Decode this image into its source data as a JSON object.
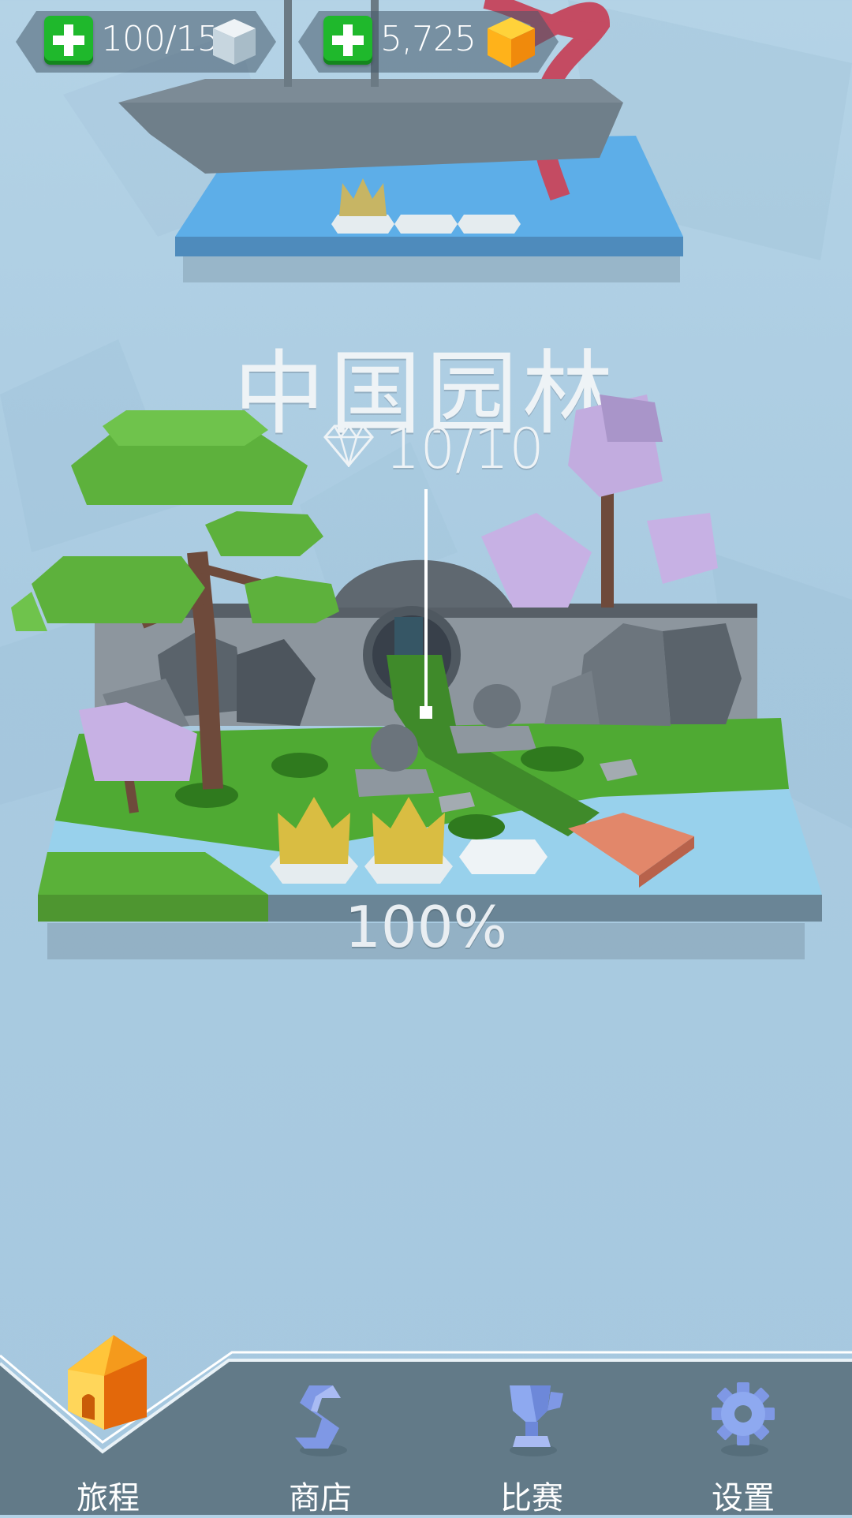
{
  "hud": {
    "energy": {
      "value": "100/15",
      "add_icon": "plus-icon",
      "resource_icon": "cube-icon"
    },
    "coins": {
      "value": "5,725",
      "add_icon": "plus-icon",
      "resource_icon": "gold-cube-icon"
    }
  },
  "level": {
    "title": "中国园林",
    "gems": "10/10",
    "gem_icon": "diamond-icon",
    "progress": "100%",
    "progress_value": 1.0,
    "crowns_earned": 2,
    "crowns_total": 3
  },
  "previous_level": {
    "crowns_earned": 1,
    "crowns_total": 3
  },
  "nav": {
    "items": [
      {
        "id": "journey",
        "label": "旅程",
        "icon": "house-icon",
        "active": true
      },
      {
        "id": "shop",
        "label": "商店",
        "icon": "shop-s-icon",
        "active": false
      },
      {
        "id": "contest",
        "label": "比赛",
        "icon": "trophy-icon",
        "active": false
      },
      {
        "id": "settings",
        "label": "设置",
        "icon": "gear-icon",
        "active": false
      }
    ]
  },
  "colors": {
    "background": "#aacbe1",
    "plus_button": "#1fb82c",
    "nav_bar": "#627a88",
    "active_house": "#f59a1c",
    "grass": "#4faa33",
    "water": "#62b1e6"
  }
}
